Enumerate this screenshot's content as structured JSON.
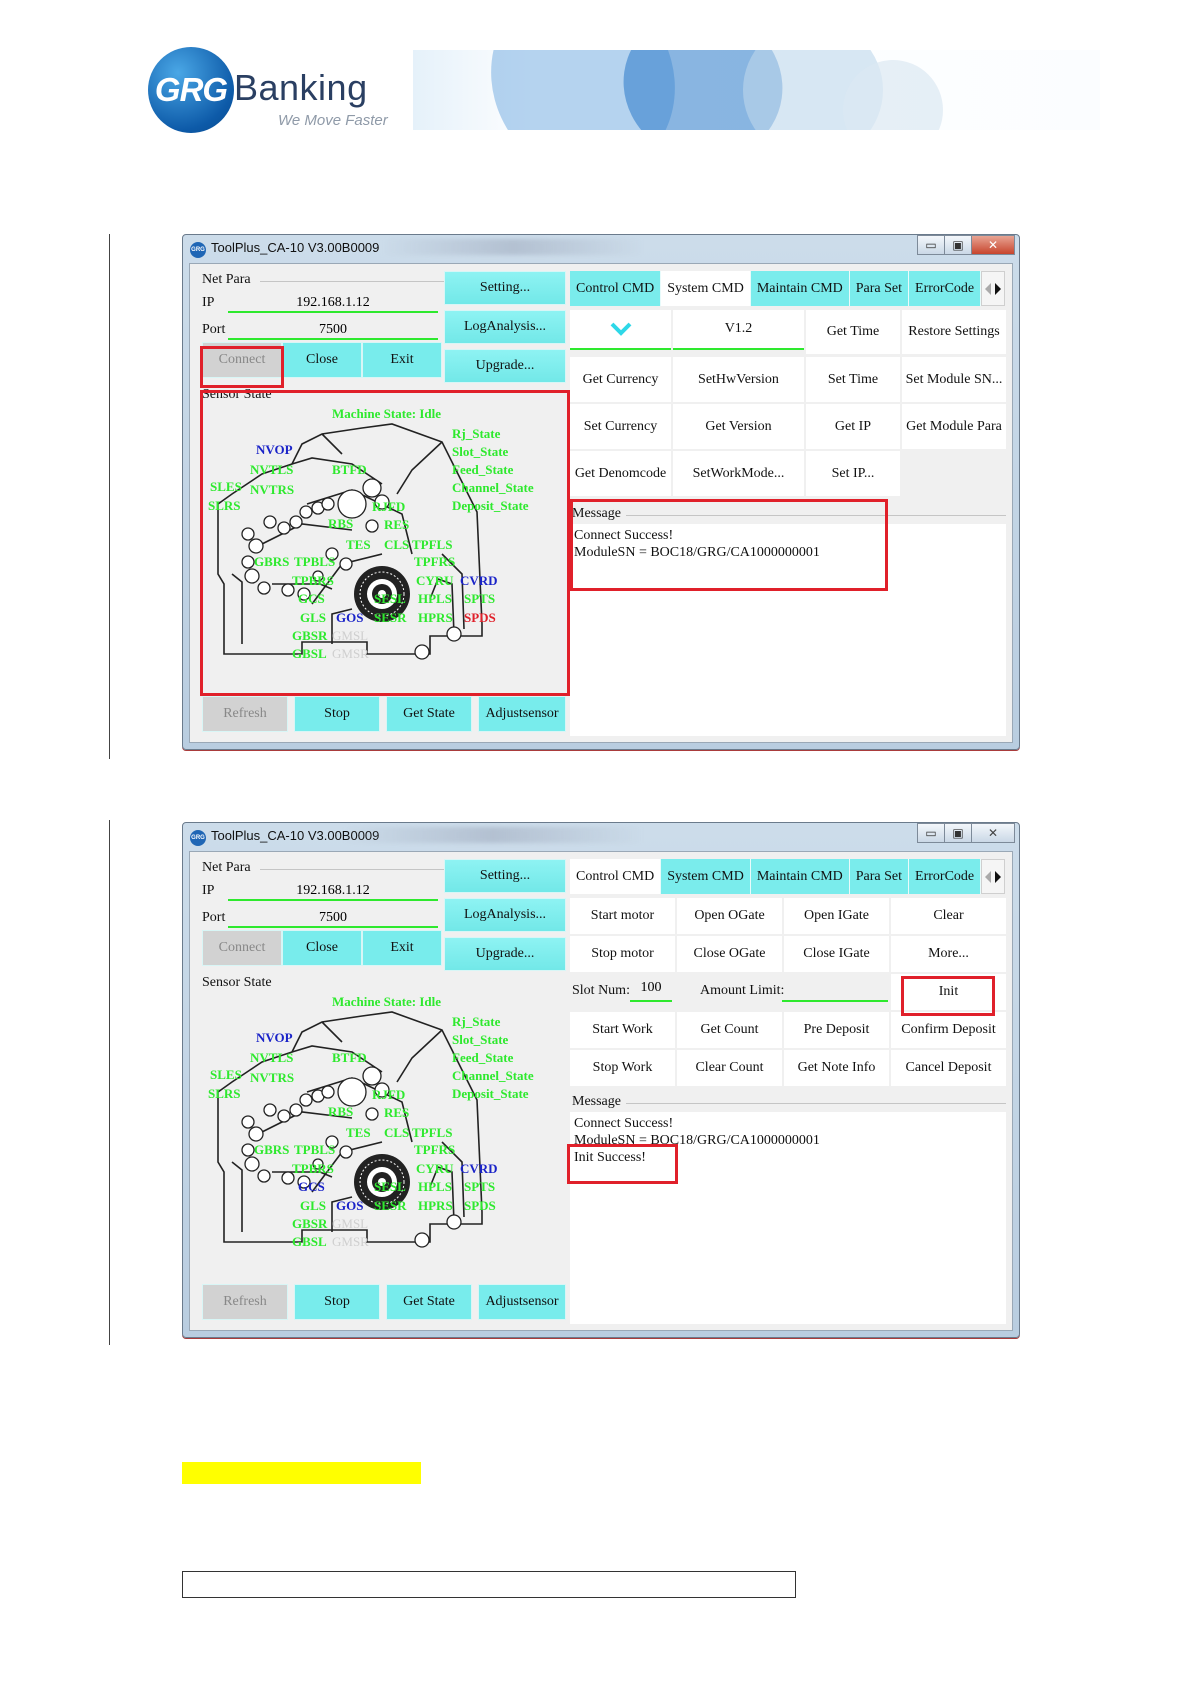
{
  "header": {
    "logo_mark": "GRG",
    "logo_word": "Banking",
    "slogan": "We Move Faster"
  },
  "colors": {
    "button_cyan": "#78ecec",
    "sensor_ok": "#2ee92e",
    "sensor_blue": "#1a23c8",
    "sensor_alert": "#e0202a",
    "annotation_red": "#e0202a",
    "highlight": "#ffff00"
  },
  "icons": {
    "app": "grg-app-icon",
    "minimize": "minimize-icon",
    "maximize": "maximize-icon",
    "close": "close-icon",
    "tab_scroll": "tab-scroll-arrows-icon",
    "dropdown": "chevron-down-icon"
  },
  "app": {
    "title": "ToolPlus_CA-10 V3.00B0009",
    "net_para": "Net Para",
    "ip_label": "IP",
    "ip_value": "192.168.1.12",
    "port_label": "Port",
    "port_value": "7500",
    "buttons": {
      "connect": "Connect",
      "close": "Close",
      "exit": "Exit",
      "setting": "Setting...",
      "log_analysis": "LogAnalysis...",
      "upgrade": "Upgrade...",
      "refresh": "Refresh",
      "stop": "Stop",
      "get_state": "Get State",
      "adjust_sensor": "Adjustsensor"
    },
    "sensor_state_label": "Sensor State",
    "tabs": [
      "Control CMD",
      "System CMD",
      "Maintain CMD",
      "Para Set",
      "ErrorCode"
    ],
    "message_label": "Message"
  },
  "sensors": {
    "machine_state": "Machine State: Idle",
    "states": [
      "Rj_State",
      "Slot_State",
      "Feed_State",
      "Channel_State",
      "Deposit_State"
    ],
    "nvop": "NVOP",
    "nvtls": "NVTLS",
    "sles": "SLES",
    "nvtrs": "NVTRS",
    "slrs": "SLRS",
    "btfd": "BTFD",
    "rjfd": "RJFD",
    "rbs": "RBS",
    "res": "RES",
    "tes": "TES",
    "cls": "CLS",
    "tpfls": "TPFLS",
    "gbrs": "GBRS",
    "tpbls": "TPBLS",
    "tpfrs": "TPFRS",
    "tpbrs": "TPBRS",
    "cyru": "CYRU",
    "cvrd": "CVRD",
    "gcs": "GCS",
    "sesl": "SESL",
    "hpls": "HPLS",
    "spts": "SPTS",
    "gls": "GLS",
    "gos": "GOS",
    "sesr": "SESR",
    "hprs": "HPRS",
    "spds": "SPDS",
    "gbsr": "GBSR",
    "gmsl": "GMSL",
    "gbsl": "GBSL",
    "gmsr": "GMSR"
  },
  "screen1": {
    "active_tab": "System CMD",
    "version": "V1.2",
    "grid": [
      [
        "Get Time",
        "Restore Settings"
      ],
      [
        "Get Currency",
        "SetHwVersion",
        "Set Time",
        "Set Module SN..."
      ],
      [
        "Set Currency",
        "Get Version",
        "Get IP",
        "Get Module Para"
      ],
      [
        "Get Denomcode",
        "SetWorkMode...",
        "Set IP..."
      ]
    ],
    "messages": [
      "Connect Success!",
      "ModuleSN = BOC18/GRG/CA1000000001"
    ]
  },
  "screen2": {
    "active_tab": "Control CMD",
    "grid_top": [
      [
        "Start motor",
        "Open OGate",
        "Open IGate",
        "Clear"
      ],
      [
        "Stop motor",
        "Close OGate",
        "Close IGate",
        "More..."
      ]
    ],
    "slot_num_label": "Slot Num:",
    "slot_num_value": "100",
    "amount_limit_label": "Amount Limit:",
    "amount_limit_value": "",
    "init": "Init",
    "grid_bottom": [
      [
        "Start Work",
        "Get Count",
        "Pre Deposit",
        "Confirm Deposit"
      ],
      [
        "Stop Work",
        "Clear Count",
        "Get Note Info",
        "Cancel Deposit"
      ]
    ],
    "messages": [
      "Connect Success!",
      "ModuleSN = BOC18/GRG/CA1000000001",
      "Init Success!"
    ]
  }
}
